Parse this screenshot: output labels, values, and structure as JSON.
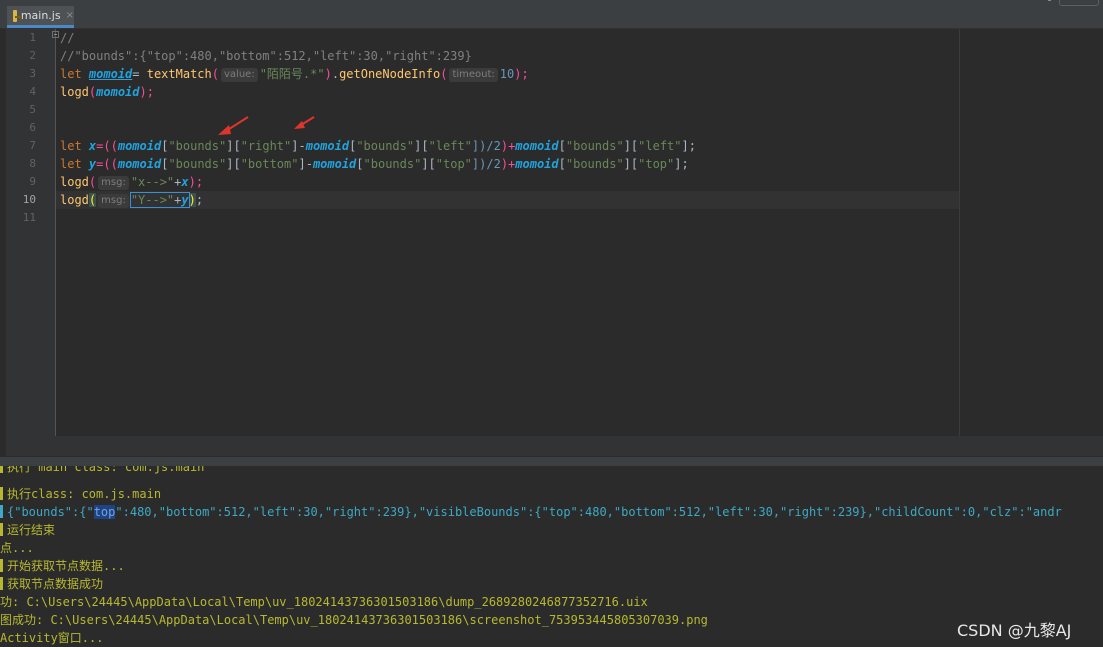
{
  "window": {
    "top_right_fragment": ""
  },
  "tab": {
    "label": "main.js",
    "close": "×"
  },
  "editor": {
    "line_numbers": [
      "1",
      "2",
      "3",
      "4",
      "5",
      "6",
      "7",
      "8",
      "9",
      "10",
      "11"
    ],
    "active_line": "10",
    "line1": {
      "text": "//"
    },
    "line2": {
      "text": "//\"bounds\":{\"top\":480,\"bottom\":512,\"left\":30,\"right\":239}"
    },
    "line3": {
      "kw": "let",
      "var": "momoid",
      "eq": "= ",
      "fn": "textMatch",
      "open": "(",
      "hint": "value:",
      "str": "\"陌陌号.*\"",
      "mid": ").",
      "fn2": "getOneNodeInfo",
      "open2": "(",
      "hint2": "timeout:",
      "num": "10",
      "close": ");"
    },
    "line4": {
      "fn": "logd",
      "open": "(",
      "var": "momoid",
      "close": ");"
    },
    "line7": {
      "kw": "let",
      "var": "x",
      "eq": "=((",
      "v1": "momoid",
      "a1": "[",
      "s1": "\"bounds\"",
      "a2": "][",
      "s2": "\"right\"",
      "a3": "]-",
      "v2": "momoid",
      "a4": "[",
      "s3": "\"bounds\"",
      "a5": "][",
      "s4": "\"left\"",
      "a6": "])/",
      "n1": "2",
      "a7": ")+",
      "v3": "momoid",
      "a8": "[",
      "s5": "\"bounds\"",
      "a9": "][",
      "s6": "\"left\"",
      "a10": "];"
    },
    "line8": {
      "kw": "let",
      "var": "y",
      "eq": "=((",
      "v1": "momoid",
      "a1": "[",
      "s1": "\"bounds\"",
      "a2": "][",
      "s2": "\"bottom\"",
      "a3": "]-",
      "v2": "momoid",
      "a4": "[",
      "s3": "\"bounds\"",
      "a5": "][",
      "s4": "\"top\"",
      "a6": "])/",
      "n1": "2",
      "a7": ")+",
      "v3": "momoid",
      "a8": "[",
      "s5": "\"bounds\"",
      "a9": "][",
      "s6": "\"top\"",
      "a10": "];"
    },
    "line9": {
      "fn": "logd",
      "open": "(",
      "hint": "msg:",
      "str": "\"x-->\"",
      "plus": "+",
      "var": "x",
      "close": ");"
    },
    "line10": {
      "fn": "logd",
      "open": "(",
      "hint": "msg:",
      "str": "\"Y-->\"",
      "plus": "+",
      "var": "y",
      "close_paren": ")",
      "semi": ";"
    }
  },
  "console": {
    "line0": "执行 main class: com.js.main",
    "line1": "执行class: com.js.main",
    "line2_pre": "{\"bounds\":{\"",
    "line2_hl": "top",
    "line2_post": "\":480,\"bottom\":512,\"left\":30,\"right\":239},\"visibleBounds\":{\"top\":480,\"bottom\":512,\"left\":30,\"right\":239},\"childCount\":0,\"clz\":\"andr",
    "line3": "运行结束",
    "line4": "点...",
    "line5": "开始获取节点数据...",
    "line6": "获取节点数据成功",
    "line7": "功: C:\\Users\\24445\\AppData\\Local\\Temp\\uv_18024143736301503186\\dump_2689280246877352716.uix",
    "line8": "图成功: C:\\Users\\24445\\AppData\\Local\\Temp\\uv_18024143736301503186\\screenshot_753953445805307039.png",
    "line9": "Activity窗口..."
  },
  "watermark": "CSDN @九黎AJ",
  "colors": {
    "keyword": "#cc7832",
    "function": "#ffc66d",
    "variable": "#20a3de",
    "string": "#6a8759",
    "console_text": "#b8b82f",
    "console_json": "#3da9c4"
  }
}
